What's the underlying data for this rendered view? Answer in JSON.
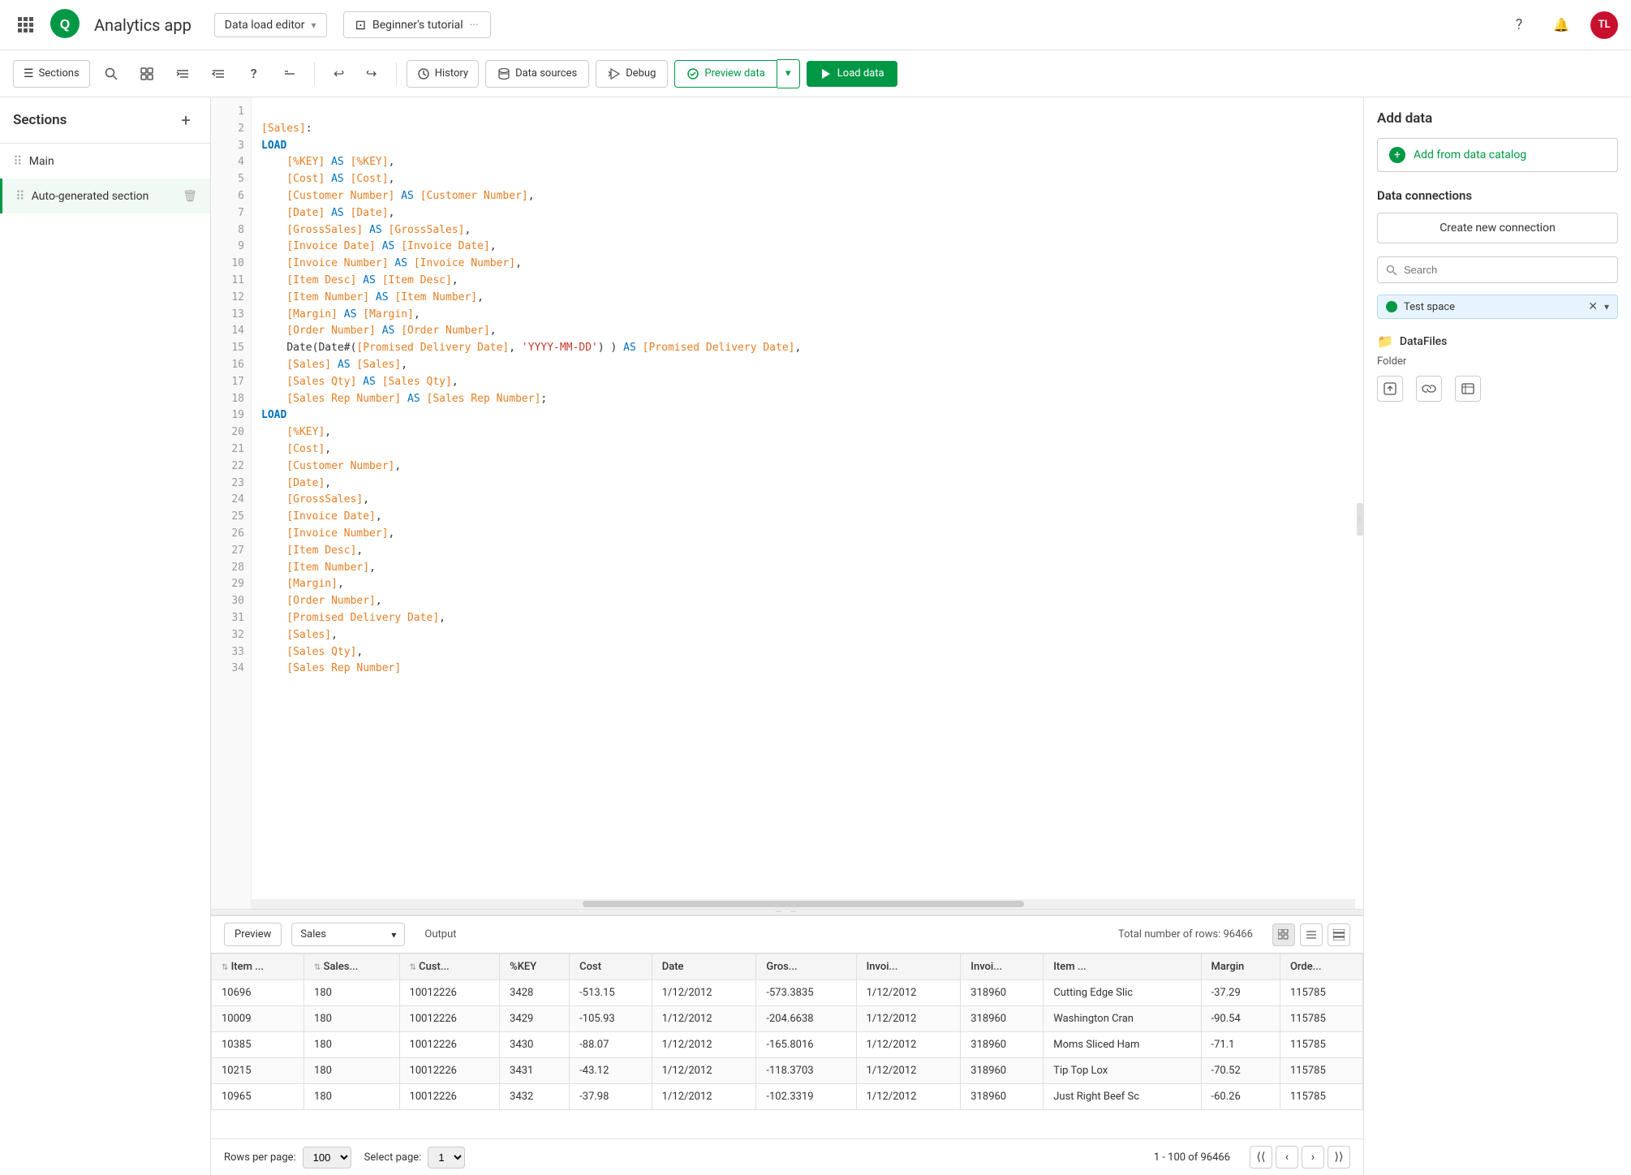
{
  "app": {
    "title": "Analytics app",
    "logo_text": "Qlik"
  },
  "editor_selector": {
    "label": "Data load editor",
    "chevron": "▾"
  },
  "tutorial_btn": {
    "label": "Beginner's tutorial",
    "more_icon": "···"
  },
  "nav": {
    "help_icon": "?",
    "bell_icon": "🔔",
    "avatar_initials": "TL"
  },
  "toolbar": {
    "sections_label": "Sections",
    "search_icon": "🔍",
    "layout_icon": "⊞",
    "indent_icon": "≡",
    "outdent_icon": "≡",
    "help_icon": "?",
    "comment_icon": "—",
    "undo_icon": "↩",
    "redo_icon": "↪",
    "history_label": "History",
    "data_sources_label": "Data sources",
    "debug_label": "Debug",
    "preview_data_label": "Preview data",
    "load_data_label": "Load data"
  },
  "sidebar": {
    "title": "Sections",
    "add_tooltip": "+",
    "items": [
      {
        "label": "Main",
        "active": false
      },
      {
        "label": "Auto-generated section",
        "active": true
      }
    ]
  },
  "code": {
    "lines": [
      {
        "n": 1,
        "text": "[Sales]:",
        "type": "bracket"
      },
      {
        "n": 2,
        "text": "LOAD",
        "type": "keyword"
      },
      {
        "n": 3,
        "text": "    [%KEY] AS [%KEY],",
        "type": "field"
      },
      {
        "n": 4,
        "text": "    [Cost] AS [Cost],",
        "type": "field"
      },
      {
        "n": 5,
        "text": "    [Customer Number] AS [Customer Number],",
        "type": "field"
      },
      {
        "n": 6,
        "text": "    [Date] AS [Date],",
        "type": "field"
      },
      {
        "n": 7,
        "text": "    [GrossSales] AS [GrossSales],",
        "type": "field"
      },
      {
        "n": 8,
        "text": "    [Invoice Date] AS [Invoice Date],",
        "type": "field"
      },
      {
        "n": 9,
        "text": "    [Invoice Number] AS [Invoice Number],",
        "type": "field"
      },
      {
        "n": 10,
        "text": "    [Item Desc] AS [Item Desc],",
        "type": "field"
      },
      {
        "n": 11,
        "text": "    [Item Number] AS [Item Number],",
        "type": "field"
      },
      {
        "n": 12,
        "text": "    [Margin] AS [Margin],",
        "type": "field"
      },
      {
        "n": 13,
        "text": "    [Order Number] AS [Order Number],",
        "type": "field"
      },
      {
        "n": 14,
        "text": "    Date(Date#([Promised Delivery Date], 'YYYY-MM-DD') ) AS [Promised Delivery Date],",
        "type": "mixed"
      },
      {
        "n": 15,
        "text": "    [Sales] AS [Sales],",
        "type": "field"
      },
      {
        "n": 16,
        "text": "    [Sales Qty] AS [Sales Qty],",
        "type": "field"
      },
      {
        "n": 17,
        "text": "    [Sales Rep Number] AS [Sales Rep Number];",
        "type": "field"
      },
      {
        "n": 18,
        "text": "LOAD",
        "type": "keyword"
      },
      {
        "n": 19,
        "text": "    [%KEY],",
        "type": "field"
      },
      {
        "n": 20,
        "text": "    [Cost],",
        "type": "field"
      },
      {
        "n": 21,
        "text": "    [Customer Number],",
        "type": "field"
      },
      {
        "n": 22,
        "text": "    [Date],",
        "type": "field"
      },
      {
        "n": 23,
        "text": "    [GrossSales],",
        "type": "field"
      },
      {
        "n": 24,
        "text": "    [Invoice Date],",
        "type": "field"
      },
      {
        "n": 25,
        "text": "    [Invoice Number],",
        "type": "field"
      },
      {
        "n": 26,
        "text": "    [Item Desc],",
        "type": "field"
      },
      {
        "n": 27,
        "text": "    [Item Number],",
        "type": "field"
      },
      {
        "n": 28,
        "text": "    [Margin],",
        "type": "field"
      },
      {
        "n": 29,
        "text": "    [Order Number],",
        "type": "field"
      },
      {
        "n": 30,
        "text": "    [Promised Delivery Date],",
        "type": "field"
      },
      {
        "n": 31,
        "text": "    [Sales],",
        "type": "field"
      },
      {
        "n": 32,
        "text": "    [Sales Qty],",
        "type": "field"
      },
      {
        "n": 33,
        "text": "    [Sales Rep Number]",
        "type": "field"
      },
      {
        "n": 34,
        "text": "",
        "type": "empty"
      }
    ]
  },
  "bottom_panel": {
    "preview_label": "Preview",
    "table_label": "Sales",
    "output_label": "Output",
    "total_rows": "Total number of rows: 96466",
    "table_headers": [
      "Item ...",
      "Sales...",
      "Cust...",
      "%KEY",
      "Cost",
      "Date",
      "Gros...",
      "Invoi...",
      "Invoi...",
      "Item ...",
      "Margin",
      "Orde..."
    ],
    "rows": [
      [
        "10696",
        "180",
        "10012226",
        "3428",
        "-513.15",
        "1/12/2012",
        "-573.3835",
        "1/12/2012",
        "318960",
        "Cutting Edge Slic",
        "-37.29",
        "115785"
      ],
      [
        "10009",
        "180",
        "10012226",
        "3429",
        "-105.93",
        "1/12/2012",
        "-204.6638",
        "1/12/2012",
        "318960",
        "Washington Cran",
        "-90.54",
        "115785"
      ],
      [
        "10385",
        "180",
        "10012226",
        "3430",
        "-88.07",
        "1/12/2012",
        "-165.8016",
        "1/12/2012",
        "318960",
        "Moms Sliced Ham",
        "-71.1",
        "115785"
      ],
      [
        "10215",
        "180",
        "10012226",
        "3431",
        "-43.12",
        "1/12/2012",
        "-118.3703",
        "1/12/2012",
        "318960",
        "Tip Top Lox",
        "-70.52",
        "115785"
      ],
      [
        "10965",
        "180",
        "10012226",
        "3432",
        "-37.98",
        "1/12/2012",
        "-102.3319",
        "1/12/2012",
        "318960",
        "Just Right Beef Sc",
        "-60.26",
        "115785"
      ]
    ],
    "rows_per_page_label": "Rows per page:",
    "rows_per_page_value": "100",
    "select_page_label": "Select page:",
    "select_page_value": "1",
    "pagination_info": "1 - 100 of 96466"
  },
  "right_panel": {
    "add_data_title": "Add data",
    "catalog_btn_label": "Add from data catalog",
    "data_connections_title": "Data connections",
    "create_connection_label": "Create new connection",
    "search_placeholder": "Search",
    "test_space_label": "Test space",
    "datafiles_label": "DataFiles",
    "folder_label": "Folder"
  }
}
